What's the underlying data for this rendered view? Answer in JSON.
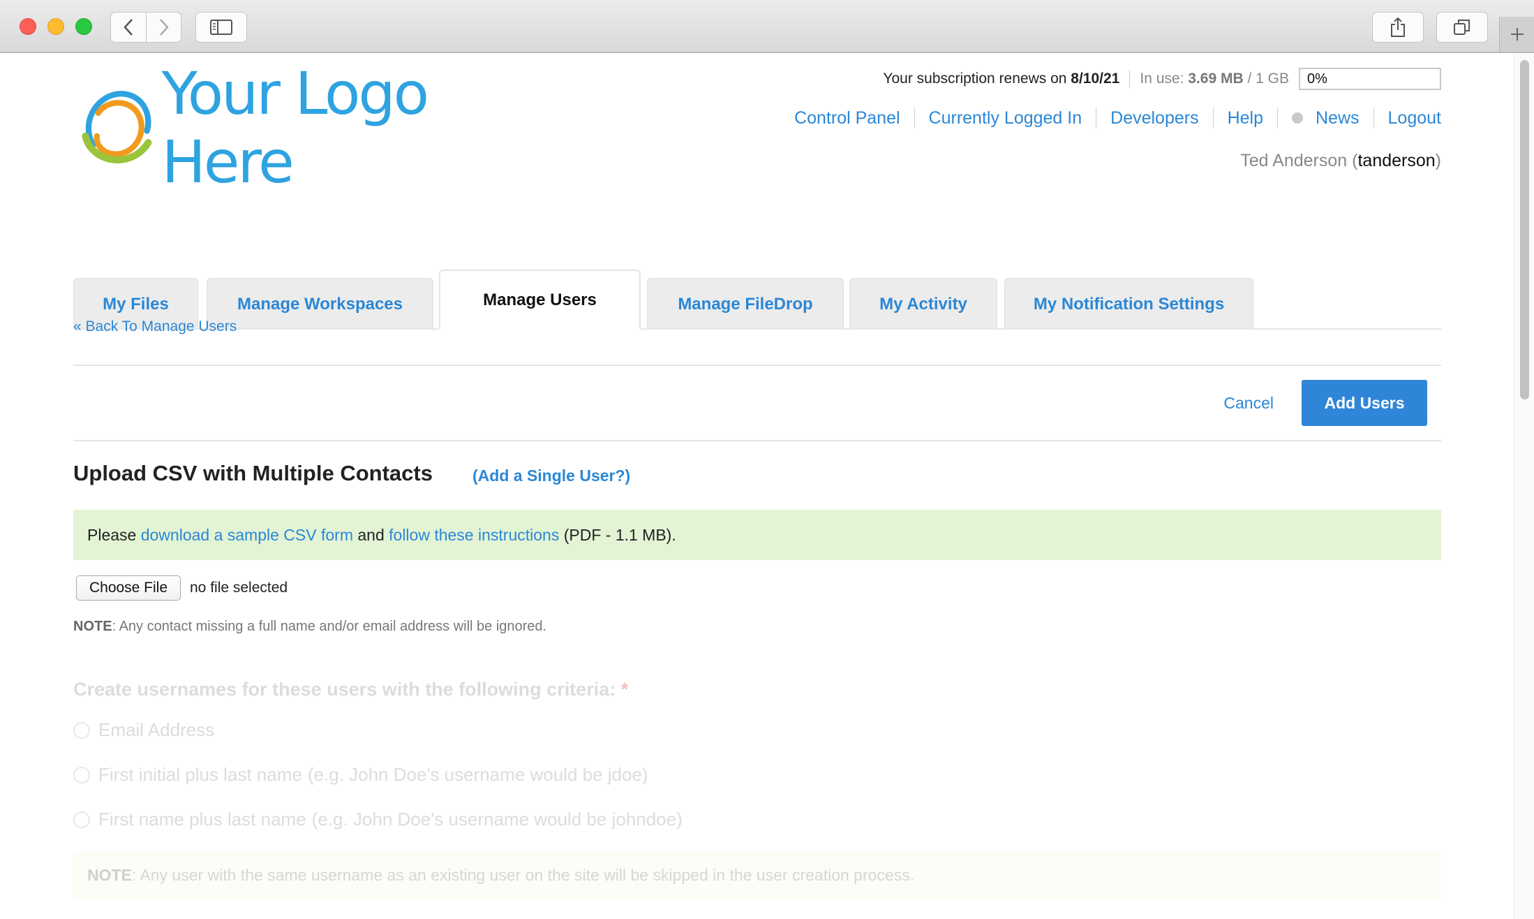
{
  "browser": {
    "back_icon": "chevron-left-icon",
    "forward_icon": "chevron-right-icon",
    "sidebar_icon": "sidebar-icon",
    "share_icon": "share-icon",
    "tabs_icon": "tabs-overview-icon",
    "new_tab_icon": "plus-icon"
  },
  "header": {
    "logo_text": "Your Logo Here",
    "subscription_label": "Your subscription renews on",
    "subscription_date": "8/10/21",
    "in_use_label": "In use:",
    "in_use_amount": "3.69 MB",
    "in_use_total": "/ 1 GB",
    "usage_percent": "0%",
    "nav": {
      "control_panel": "Control Panel",
      "currently_logged_in": "Currently Logged In",
      "developers": "Developers",
      "help": "Help",
      "news": "News",
      "logout": "Logout"
    },
    "user_full_name": "Ted Anderson",
    "user_name_open": "(",
    "username": "tanderson",
    "user_name_close": ")"
  },
  "tabs": [
    {
      "label": "My Files"
    },
    {
      "label": "Manage Workspaces"
    },
    {
      "label": "Manage Users"
    },
    {
      "label": "Manage FileDrop"
    },
    {
      "label": "My Activity"
    },
    {
      "label": "My Notification Settings"
    }
  ],
  "active_tab": "Manage Users",
  "back_link": "« Back To Manage Users",
  "actions": {
    "cancel": "Cancel",
    "add_users": "Add Users"
  },
  "upload": {
    "title": "Upload CSV with Multiple Contacts",
    "single_user_link": "(Add a Single User?)",
    "notice_prefix": "Please",
    "notice_link1": "download a sample CSV form",
    "notice_and": "and",
    "notice_link2": "follow these instructions",
    "notice_suffix": "(PDF - 1.1 MB).",
    "choose_file": "Choose File",
    "no_file": "no file selected",
    "note_label": "NOTE",
    "note_text": ": Any contact missing a full name and/or email address will be ignored."
  },
  "criteria": {
    "title": "Create usernames for these users with the following criteria:",
    "required_mark": "*",
    "options": [
      {
        "label": "Email Address",
        "hint": ""
      },
      {
        "label": "First initial plus last name",
        "hint": "(e.g. John Doe's username would be jdoe)"
      },
      {
        "label": "First name plus last name",
        "hint": "(e.g. John Doe's username would be johndoe)"
      }
    ],
    "note_label": "NOTE",
    "note_text": ": Any user with the same username as an existing user on the site will be skipped in the user creation process."
  }
}
